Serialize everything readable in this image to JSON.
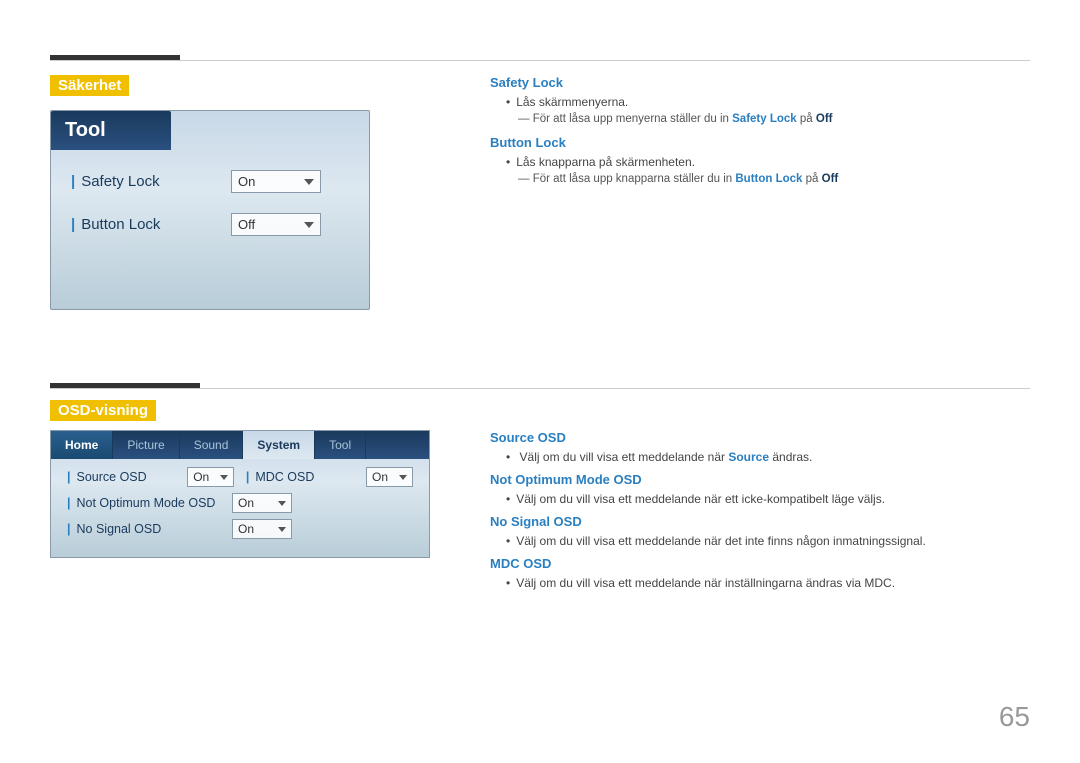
{
  "page": {
    "number": "65"
  },
  "sakerhet": {
    "label": "Säkerhet",
    "tool_header": "Tool",
    "safety_lock_label": "Safety Lock",
    "safety_lock_value": "On",
    "button_lock_label": "Button Lock",
    "button_lock_value": "Off"
  },
  "sakerhet_desc": {
    "safety_lock_title": "Safety Lock",
    "safety_lock_bullet": "Lås skärmmenyerna.",
    "safety_lock_note_pre": "För att låsa upp menyerna ställer du in ",
    "safety_lock_note_link": "Safety Lock",
    "safety_lock_note_mid": " på ",
    "safety_lock_note_val": "Off",
    "button_lock_title": "Button Lock",
    "button_lock_bullet": "Lås knapparna på skärmenheten.",
    "button_lock_note_pre": "För att låsa upp knapparna ställer du in ",
    "button_lock_note_link": "Button Lock",
    "button_lock_note_mid": " på ",
    "button_lock_note_val": "Off"
  },
  "osd": {
    "label": "OSD-visning",
    "tabs": [
      "Home",
      "Picture",
      "Sound",
      "System",
      "Tool"
    ],
    "active_tab": "System",
    "rows": [
      {
        "label": "Source OSD",
        "value": "On",
        "secondary_label": "MDC OSD",
        "secondary_value": "On"
      },
      {
        "label": "Not Optimum Mode OSD",
        "value": "On"
      },
      {
        "label": "No Signal OSD",
        "value": "On"
      }
    ]
  },
  "osd_desc": {
    "source_osd_title": "Source OSD",
    "source_osd_bullet": "Välj om du vill visa ett meddelande när ",
    "source_osd_link": "Source",
    "source_osd_bullet_end": " ändras.",
    "not_optimum_title": "Not Optimum Mode OSD",
    "not_optimum_bullet": "Välj om du vill visa ett meddelande när ett icke-kompatibelt läge väljs.",
    "no_signal_title": "No Signal OSD",
    "no_signal_bullet": "Välj om du vill visa ett meddelande när det inte finns någon inmatningssignal.",
    "mdc_osd_title": "MDC OSD",
    "mdc_osd_bullet": "Välj om du vill visa ett meddelande när inställningarna ändras via MDC."
  }
}
